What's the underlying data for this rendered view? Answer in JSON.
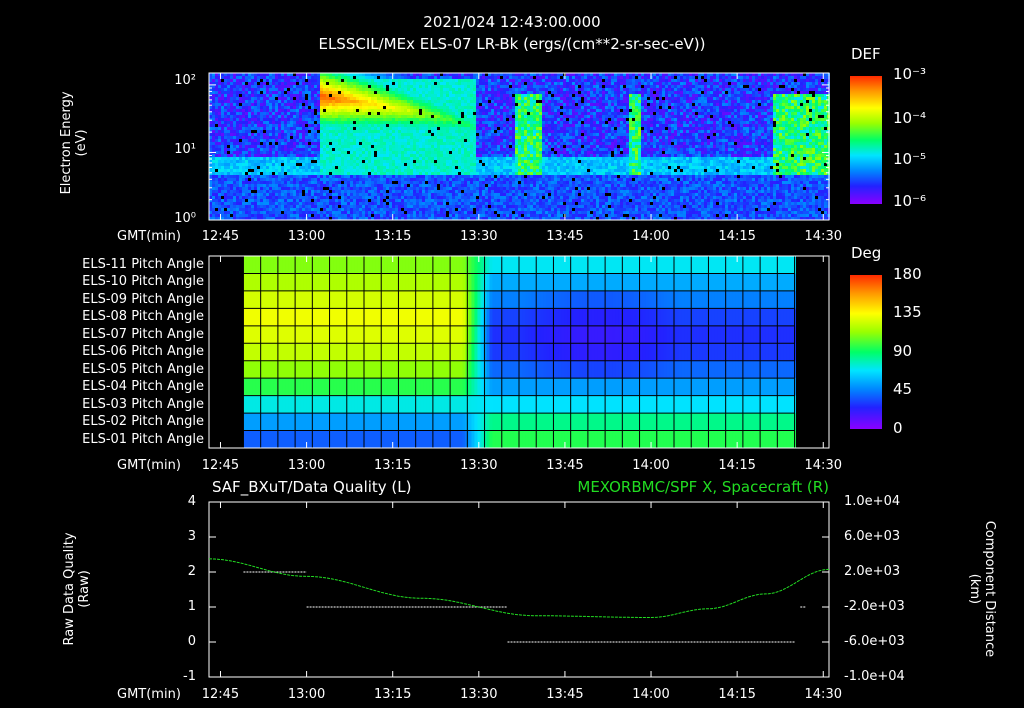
{
  "header": {
    "timestamp": "2021/024 12:43:00.000",
    "subtitle": "ELSSCIL/MEx ELS-07 LR-Bk  (ergs/(cm**2-sr-sec-eV))"
  },
  "colors": {
    "background": "#000000",
    "axis": "#ffffff",
    "spf_line": "#22dd22",
    "quality_points": "#ffffff"
  },
  "chart_data": [
    {
      "type": "heatmap",
      "name": "electron-spectrogram",
      "ylabel": "Electron Energy\n(eV)",
      "xlabel": "GMT(min)",
      "y_scale": "log",
      "ylim": [
        1,
        150
      ],
      "y_ticks": [
        "10²",
        "10¹",
        "10⁰"
      ],
      "x_ticks": [
        "12:45",
        "13:00",
        "13:15",
        "13:30",
        "13:45",
        "14:00",
        "14:15",
        "14:30"
      ],
      "xlim_minutes": [
        763,
        871
      ],
      "colorbar": {
        "label": "DEF",
        "scale": "log",
        "ticks": [
          "10⁻³",
          "10⁻⁴",
          "10⁻⁵",
          "10⁻⁶"
        ]
      }
    },
    {
      "type": "heatmap",
      "name": "pitch-angle",
      "xlabel": "GMT(min)",
      "rows": [
        "ELS-11 Pitch Angle",
        "ELS-10 Pitch Angle",
        "ELS-09 Pitch Angle",
        "ELS-08 Pitch Angle",
        "ELS-07 Pitch Angle",
        "ELS-06 Pitch Angle",
        "ELS-05 Pitch Angle",
        "ELS-04 Pitch Angle",
        "ELS-03 Pitch Angle",
        "ELS-02 Pitch Angle",
        "ELS-01 Pitch Angle"
      ],
      "x_ticks": [
        "12:45",
        "13:00",
        "13:15",
        "13:30",
        "13:45",
        "14:00",
        "14:15",
        "14:30"
      ],
      "xlim_minutes": [
        763,
        871
      ],
      "data_start_minute": 769,
      "data_end_minute": 865,
      "row_angles_before_1347": [
        110,
        118,
        126,
        132,
        128,
        122,
        112,
        96,
        72,
        52,
        38
      ],
      "row_angles_after_1347": [
        70,
        55,
        45,
        32,
        28,
        30,
        40,
        52,
        68,
        85,
        95
      ],
      "colorbar": {
        "label": "Deg",
        "ticks": [
          "180",
          "135",
          "90",
          "45",
          "0"
        ],
        "range": [
          0,
          180
        ]
      }
    },
    {
      "type": "line",
      "name": "data-quality-and-spf",
      "left_title": "SAF_BXuT/Data Quality (L)",
      "right_title": "MEXORBMC/SPF X, Spacecraft (R)",
      "ylabel_left": "Raw Data Quality\n(Raw)",
      "ylabel_right": "Component Distance\n(km)",
      "xlabel": "GMT(min)",
      "ylim_left": [
        -1,
        4
      ],
      "y_ticks_left": [
        "4",
        "3",
        "2",
        "1",
        "0",
        "-1"
      ],
      "ylim_right": [
        -10000,
        10000
      ],
      "y_ticks_right": [
        "1.0e+04",
        "6.0e+03",
        "2.0e+03",
        "-2.0e+03",
        "-6.0e+03",
        "-1.0e+04"
      ],
      "x_ticks": [
        "12:45",
        "13:00",
        "13:15",
        "13:30",
        "13:45",
        "14:00",
        "14:15",
        "14:30"
      ],
      "xlim_minutes": [
        763,
        871
      ],
      "quality_segments": [
        {
          "start": 769,
          "end": 780,
          "value": 2
        },
        {
          "start": 780,
          "end": 815,
          "value": 1
        },
        {
          "start": 815,
          "end": 865,
          "value": 0
        },
        {
          "start": 866,
          "end": 867,
          "value": 1
        }
      ],
      "spf_x": [
        763,
        780,
        800,
        820,
        840,
        850,
        860,
        871
      ],
      "spf_y": [
        3500,
        1500,
        -1000,
        -3000,
        -3200,
        -2200,
        -500,
        2300
      ]
    }
  ]
}
